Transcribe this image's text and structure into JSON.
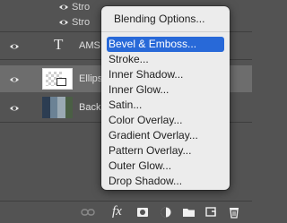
{
  "layers_panel": {
    "effect_rows": [
      {
        "label": "Stro"
      },
      {
        "label": "Stro"
      }
    ],
    "layers": [
      {
        "name": "AMS",
        "kind": "type",
        "glyph": "T",
        "selected": false
      },
      {
        "name": "Ellipse",
        "kind": "shape",
        "selected": true
      },
      {
        "name": "Backgr",
        "kind": "photo",
        "selected": false
      }
    ],
    "toolbar": {
      "link_icon": "link-icon",
      "fx_label": "fx",
      "mask_icon": "mask-icon",
      "adjustment_icon": "adjustment-icon",
      "group_icon": "folder-icon",
      "new_layer_icon": "new-layer-icon",
      "delete_icon": "trash-icon"
    }
  },
  "context_menu": {
    "items": [
      {
        "label": "Blending Options...",
        "highlighted": false
      },
      {
        "label": "Bevel & Emboss...",
        "highlighted": true
      },
      {
        "label": "Stroke...",
        "highlighted": false
      },
      {
        "label": "Inner Shadow...",
        "highlighted": false
      },
      {
        "label": "Inner Glow...",
        "highlighted": false
      },
      {
        "label": "Satin...",
        "highlighted": false
      },
      {
        "label": "Color Overlay...",
        "highlighted": false
      },
      {
        "label": "Gradient Overlay...",
        "highlighted": false
      },
      {
        "label": "Pattern Overlay...",
        "highlighted": false
      },
      {
        "label": "Outer Glow...",
        "highlighted": false
      },
      {
        "label": "Drop Shadow...",
        "highlighted": false
      }
    ]
  },
  "colors": {
    "panel_bg": "#535353",
    "selected_row": "#6d6d6d",
    "menu_bg": "#ececec",
    "menu_highlight": "#2869d8"
  }
}
